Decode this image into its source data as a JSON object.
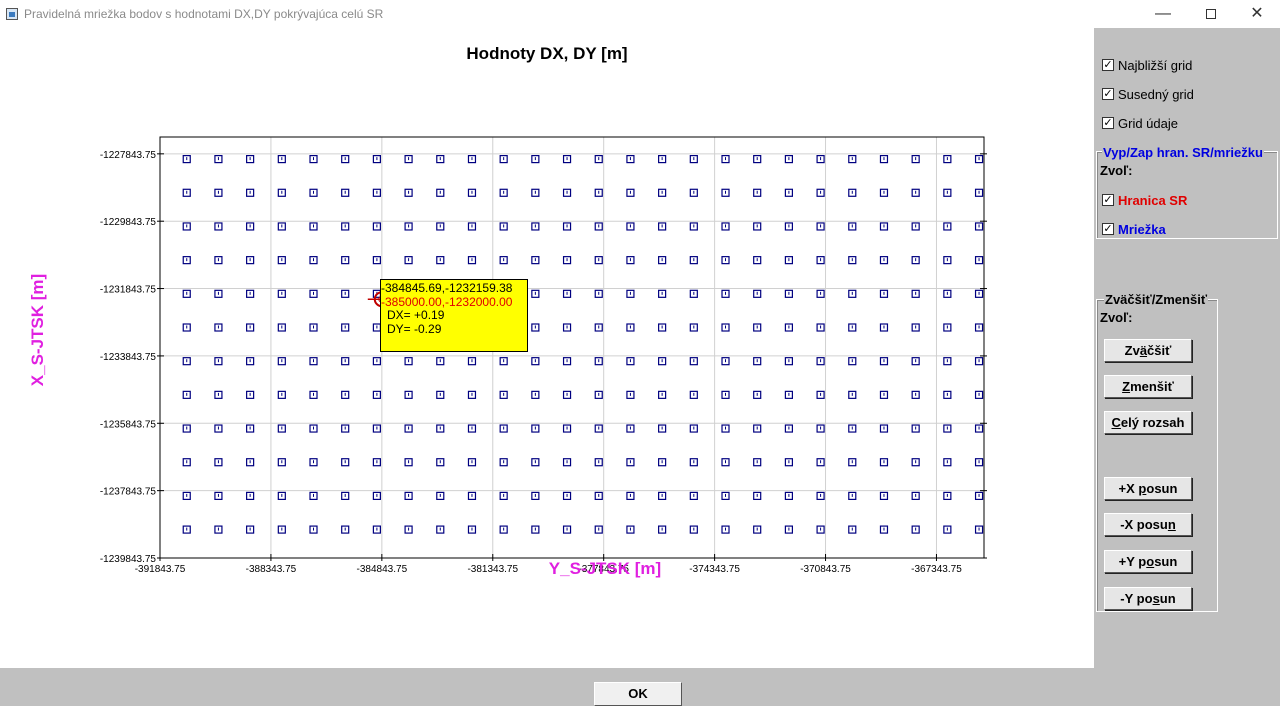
{
  "window": {
    "title": "Pravidelná mriežka bodov s hodnotami DX,DY pokrývajúca celú SR",
    "controls": {
      "minimize": "—",
      "close": "✕"
    }
  },
  "chart_data": {
    "type": "scatter",
    "title": "Hodnoty DX, DY [m]",
    "xlabel": "Y_S-JTSK [m]",
    "ylabel": "X_S-JTSK [m]",
    "xlim": [
      -391843.75,
      -365843.75
    ],
    "ylim": [
      -1239843.75,
      -1227343.75
    ],
    "grid": true,
    "x_ticks": [
      "-391843.75",
      "-388343.75",
      "-384843.75",
      "-381343.75",
      "-377843.75",
      "-374343.75",
      "-370843.75",
      "-367343.75"
    ],
    "x_tick_values": [
      -391843.75,
      -388343.75,
      -384843.75,
      -381343.75,
      -377843.75,
      -374343.75,
      -370843.75,
      -367343.75
    ],
    "y_ticks": [
      "-1227843.75",
      "-1229843.75",
      "-1231843.75",
      "-1233843.75",
      "-1235843.75",
      "-1237843.75",
      "-1239843.75"
    ],
    "y_tick_values": [
      -1227843.75,
      -1229843.75,
      -1231843.75,
      -1233843.75,
      -1235843.75,
      -1237843.75,
      -1239843.75
    ],
    "grid_points": {
      "marker": "square",
      "marker_color": "#000080",
      "x_start": -391000,
      "x_step": 1000,
      "x_count": 26,
      "y_start": -1228000,
      "y_step": -1000,
      "y_count": 12
    },
    "cursor": {
      "x": -384845.69,
      "y": -1232159.38
    },
    "tooltip": {
      "cursor_coords": "-384845.69,-1232159.38",
      "grid_coords": "-385000.00,-1232000.00",
      "dx": "DX= +0.19",
      "dy": "DY= -0.29"
    }
  },
  "side": {
    "chk_najblizsi": {
      "label": "Najbližší grid",
      "checked": "✓"
    },
    "chk_susedny": {
      "label": "Susedný grid",
      "checked": "✓"
    },
    "chk_grid_udaje": {
      "label": "Grid údaje",
      "checked": "✓"
    },
    "group1": {
      "label": "Vyp/Zap hran. SR/mriežku",
      "zvol": "Zvoľ:",
      "hranica": {
        "label": "Hranica SR",
        "checked": "✓",
        "color": "#e00000"
      },
      "mriezka": {
        "label": "Mriežka",
        "checked": "✓",
        "color": "#0000e0"
      }
    },
    "group2": {
      "label": "Zväčšiť/Zmenšiť",
      "zvol": "Zvoľ:",
      "zvacsit": {
        "pre": "Zv",
        "u": "ä",
        "post": "čšiť"
      },
      "zmensit": {
        "pre": "",
        "u": "Z",
        "post": "menšiť"
      },
      "cely": {
        "pre": "",
        "u": "C",
        "post": "elý rozsah"
      },
      "plus_x": {
        "pre": "+X ",
        "u": "p",
        "post": "osun"
      },
      "minus_x": {
        "pre": "-X posu",
        "u": "n",
        "post": ""
      },
      "plus_y": {
        "pre": "+Y p",
        "u": "o",
        "post": "sun"
      },
      "minus_y": {
        "pre": "-Y po",
        "u": "s",
        "post": "un"
      }
    }
  },
  "ok_label": "OK"
}
